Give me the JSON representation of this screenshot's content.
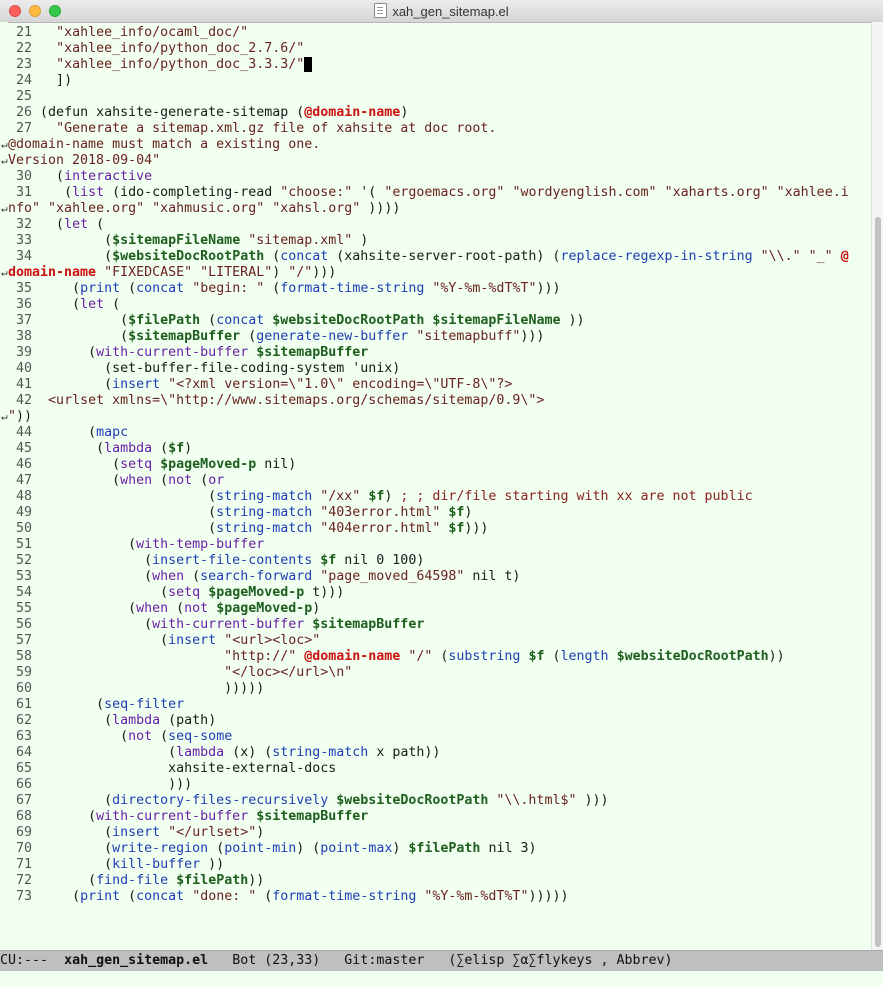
{
  "window": {
    "title": "xah_gen_sitemap.el"
  },
  "modeline": {
    "status": "CU:---",
    "buffer_name": "xah_gen_sitemap.el",
    "position": "Bot (23,33)",
    "vc": "Git:master",
    "modes": "(∑elisp ∑α∑flykeys , Abbrev)"
  },
  "editor": {
    "lines": [
      [
        [
          "num",
          "21"
        ],
        [
          "t",
          "  "
        ],
        [
          "st",
          "\"xahlee_info/ocaml_doc/\""
        ]
      ],
      [
        [
          "num",
          "22"
        ],
        [
          "t",
          "  "
        ],
        [
          "st",
          "\"xahlee_info/python_doc_2.7.6/\""
        ]
      ],
      [
        [
          "num",
          "23"
        ],
        [
          "t",
          "  "
        ],
        [
          "st",
          "\"xahlee_info/python_doc_3.3.3/\""
        ],
        [
          "cursor",
          " "
        ]
      ],
      [
        [
          "num",
          "24"
        ],
        [
          "t",
          "  ])"
        ]
      ],
      [
        [
          "num",
          "25"
        ]
      ],
      [
        [
          "num",
          "26"
        ],
        [
          "t",
          "(defun xahsite-generate-sitemap ("
        ],
        [
          "par",
          "@domain-name"
        ],
        [
          "t",
          ")"
        ]
      ],
      [
        [
          "num",
          "27"
        ],
        [
          "t",
          "  "
        ],
        [
          "st",
          "\"Generate a sitemap.xml.gz file of xahsite at doc root."
        ]
      ],
      [
        [
          "st",
          "@domain-name must match a existing one."
        ]
      ],
      [
        [
          "st",
          "Version 2018-09-04\""
        ]
      ],
      [
        [
          "num",
          "30"
        ],
        [
          "t",
          "  ("
        ],
        [
          "kw",
          "interactive"
        ]
      ],
      [
        [
          "num",
          "31"
        ],
        [
          "t",
          "   ("
        ],
        [
          "kw",
          "list"
        ],
        [
          "t",
          " (ido-completing-read "
        ],
        [
          "st",
          "\"choose:\""
        ],
        [
          "t",
          " '( "
        ],
        [
          "st",
          "\"ergoemacs.org\""
        ],
        [
          "t",
          " "
        ],
        [
          "st",
          "\"wordyenglish.com\""
        ],
        [
          "t",
          " "
        ],
        [
          "st",
          "\"xaharts.org\""
        ],
        [
          "t",
          " "
        ],
        [
          "st",
          "\"xahlee.i"
        ]
      ],
      [
        [
          "st",
          "nfo\""
        ],
        [
          "t",
          " "
        ],
        [
          "st",
          "\"xahlee.org\""
        ],
        [
          "t",
          " "
        ],
        [
          "st",
          "\"xahmusic.org\""
        ],
        [
          "t",
          " "
        ],
        [
          "st",
          "\"xahsl.org\""
        ],
        [
          "t",
          " ))))"
        ]
      ],
      [
        [
          "num",
          "32"
        ],
        [
          "t",
          "  ("
        ],
        [
          "kw",
          "let"
        ],
        [
          "t",
          " ("
        ]
      ],
      [
        [
          "num",
          "33"
        ],
        [
          "t",
          "        ("
        ],
        [
          "var",
          "$sitemapFileName"
        ],
        [
          "t",
          " "
        ],
        [
          "st",
          "\"sitemap.xml\""
        ],
        [
          "t",
          " )"
        ]
      ],
      [
        [
          "num",
          "34"
        ],
        [
          "t",
          "        ("
        ],
        [
          "var",
          "$websiteDocRootPath"
        ],
        [
          "t",
          " ("
        ],
        [
          "fn",
          "concat"
        ],
        [
          "t",
          " (xahsite-server-root-path) ("
        ],
        [
          "fn",
          "replace-regexp-in-string"
        ],
        [
          "t",
          " "
        ],
        [
          "st",
          "\"\\\\.\""
        ],
        [
          "t",
          " "
        ],
        [
          "st",
          "\"_\""
        ],
        [
          "t",
          " "
        ],
        [
          "par",
          "@"
        ]
      ],
      [
        [
          "par",
          "domain-name"
        ],
        [
          "t",
          " "
        ],
        [
          "st",
          "\"FIXEDCASE\""
        ],
        [
          "t",
          " "
        ],
        [
          "st",
          "\"LITERAL\""
        ],
        [
          "t",
          ") "
        ],
        [
          "st",
          "\"/\""
        ],
        [
          "t",
          ")))"
        ]
      ],
      [
        [
          "num",
          "35"
        ],
        [
          "t",
          "    ("
        ],
        [
          "fn",
          "print"
        ],
        [
          "t",
          " ("
        ],
        [
          "fn",
          "concat"
        ],
        [
          "t",
          " "
        ],
        [
          "st",
          "\"begin: \""
        ],
        [
          "t",
          " ("
        ],
        [
          "fn",
          "format-time-string"
        ],
        [
          "t",
          " "
        ],
        [
          "st",
          "\"%Y-%m-%dT%T\""
        ],
        [
          "t",
          ")))"
        ]
      ],
      [
        [
          "num",
          "36"
        ],
        [
          "t",
          "    ("
        ],
        [
          "kw",
          "let"
        ],
        [
          "t",
          " ("
        ]
      ],
      [
        [
          "num",
          "37"
        ],
        [
          "t",
          "          ("
        ],
        [
          "var",
          "$filePath"
        ],
        [
          "t",
          " ("
        ],
        [
          "fn",
          "concat"
        ],
        [
          "t",
          " "
        ],
        [
          "var",
          "$websiteDocRootPath"
        ],
        [
          "t",
          " "
        ],
        [
          "var",
          "$sitemapFileName"
        ],
        [
          "t",
          " ))"
        ]
      ],
      [
        [
          "num",
          "38"
        ],
        [
          "t",
          "          ("
        ],
        [
          "var",
          "$sitemapBuffer"
        ],
        [
          "t",
          " ("
        ],
        [
          "fn",
          "generate-new-buffer"
        ],
        [
          "t",
          " "
        ],
        [
          "st",
          "\"sitemapbuff\""
        ],
        [
          "t",
          ")))"
        ]
      ],
      [
        [
          "num",
          "39"
        ],
        [
          "t",
          "      ("
        ],
        [
          "kw",
          "with-current-buffer"
        ],
        [
          "t",
          " "
        ],
        [
          "var",
          "$sitemapBuffer"
        ]
      ],
      [
        [
          "num",
          "40"
        ],
        [
          "t",
          "        (set-buffer-file-coding-system 'unix)"
        ]
      ],
      [
        [
          "num",
          "41"
        ],
        [
          "t",
          "        ("
        ],
        [
          "fn",
          "insert"
        ],
        [
          "t",
          " "
        ],
        [
          "st",
          "\"<?xml version=\\\"1.0\\\" encoding=\\\"UTF-8\\\"?>"
        ]
      ],
      [
        [
          "num",
          "42"
        ],
        [
          "st",
          " <urlset xmlns=\\\"http://www.sitemaps.org/schemas/sitemap/0.9\\\">"
        ]
      ],
      [
        [
          "st",
          "\""
        ],
        [
          "t",
          "))"
        ]
      ],
      [
        [
          "num",
          "44"
        ],
        [
          "t",
          "      ("
        ],
        [
          "fn",
          "mapc"
        ]
      ],
      [
        [
          "num",
          "45"
        ],
        [
          "t",
          "       ("
        ],
        [
          "kw",
          "lambda"
        ],
        [
          "t",
          " ("
        ],
        [
          "var",
          "$f"
        ],
        [
          "t",
          ")"
        ]
      ],
      [
        [
          "num",
          "46"
        ],
        [
          "t",
          "         ("
        ],
        [
          "kw",
          "setq"
        ],
        [
          "t",
          " "
        ],
        [
          "var",
          "$pageMoved-p"
        ],
        [
          "t",
          " nil)"
        ]
      ],
      [
        [
          "num",
          "47"
        ],
        [
          "t",
          "         ("
        ],
        [
          "kw",
          "when"
        ],
        [
          "t",
          " ("
        ],
        [
          "kw",
          "not"
        ],
        [
          "t",
          " ("
        ],
        [
          "kw",
          "or"
        ]
      ],
      [
        [
          "num",
          "48"
        ],
        [
          "t",
          "                     ("
        ],
        [
          "fn",
          "string-match"
        ],
        [
          "t",
          " "
        ],
        [
          "st",
          "\"/xx\""
        ],
        [
          "t",
          " "
        ],
        [
          "var",
          "$f"
        ],
        [
          "t",
          ") "
        ],
        [
          "cm",
          "; ; dir/file starting with xx are not public"
        ]
      ],
      [
        [
          "num",
          "49"
        ],
        [
          "t",
          "                     ("
        ],
        [
          "fn",
          "string-match"
        ],
        [
          "t",
          " "
        ],
        [
          "st",
          "\"403error.html\""
        ],
        [
          "t",
          " "
        ],
        [
          "var",
          "$f"
        ],
        [
          "t",
          ")"
        ]
      ],
      [
        [
          "num",
          "50"
        ],
        [
          "t",
          "                     ("
        ],
        [
          "fn",
          "string-match"
        ],
        [
          "t",
          " "
        ],
        [
          "st",
          "\"404error.html\""
        ],
        [
          "t",
          " "
        ],
        [
          "var",
          "$f"
        ],
        [
          "t",
          ")))"
        ]
      ],
      [
        [
          "num",
          "51"
        ],
        [
          "t",
          "           ("
        ],
        [
          "kw",
          "with-temp-buffer"
        ]
      ],
      [
        [
          "num",
          "52"
        ],
        [
          "t",
          "             ("
        ],
        [
          "fn",
          "insert-file-contents"
        ],
        [
          "t",
          " "
        ],
        [
          "var",
          "$f"
        ],
        [
          "t",
          " nil 0 100)"
        ]
      ],
      [
        [
          "num",
          "53"
        ],
        [
          "t",
          "             ("
        ],
        [
          "kw",
          "when"
        ],
        [
          "t",
          " ("
        ],
        [
          "fn",
          "search-forward"
        ],
        [
          "t",
          " "
        ],
        [
          "st",
          "\"page_moved_64598\""
        ],
        [
          "t",
          " nil t)"
        ]
      ],
      [
        [
          "num",
          "54"
        ],
        [
          "t",
          "               ("
        ],
        [
          "kw",
          "setq"
        ],
        [
          "t",
          " "
        ],
        [
          "var",
          "$pageMoved-p"
        ],
        [
          "t",
          " t)))"
        ]
      ],
      [
        [
          "num",
          "55"
        ],
        [
          "t",
          "           ("
        ],
        [
          "kw",
          "when"
        ],
        [
          "t",
          " ("
        ],
        [
          "kw",
          "not"
        ],
        [
          "t",
          " "
        ],
        [
          "var",
          "$pageMoved-p"
        ],
        [
          "t",
          ")"
        ]
      ],
      [
        [
          "num",
          "56"
        ],
        [
          "t",
          "             ("
        ],
        [
          "kw",
          "with-current-buffer"
        ],
        [
          "t",
          " "
        ],
        [
          "var",
          "$sitemapBuffer"
        ]
      ],
      [
        [
          "num",
          "57"
        ],
        [
          "t",
          "               ("
        ],
        [
          "fn",
          "insert"
        ],
        [
          "t",
          " "
        ],
        [
          "st",
          "\"<url><loc>\""
        ]
      ],
      [
        [
          "num",
          "58"
        ],
        [
          "t",
          "                       "
        ],
        [
          "st",
          "\"http://\""
        ],
        [
          "t",
          " "
        ],
        [
          "par",
          "@domain-name"
        ],
        [
          "t",
          " "
        ],
        [
          "st",
          "\"/\""
        ],
        [
          "t",
          " ("
        ],
        [
          "fn",
          "substring"
        ],
        [
          "t",
          " "
        ],
        [
          "var",
          "$f"
        ],
        [
          "t",
          " ("
        ],
        [
          "fn",
          "length"
        ],
        [
          "t",
          " "
        ],
        [
          "var",
          "$websiteDocRootPath"
        ],
        [
          "t",
          "))"
        ]
      ],
      [
        [
          "num",
          "59"
        ],
        [
          "t",
          "                       "
        ],
        [
          "st",
          "\"</loc></url>\\n\""
        ]
      ],
      [
        [
          "num",
          "60"
        ],
        [
          "t",
          "                       )))))"
        ]
      ],
      [
        [
          "num",
          "61"
        ],
        [
          "t",
          "       ("
        ],
        [
          "fn",
          "seq-filter"
        ]
      ],
      [
        [
          "num",
          "62"
        ],
        [
          "t",
          "        ("
        ],
        [
          "kw",
          "lambda"
        ],
        [
          "t",
          " (path)"
        ]
      ],
      [
        [
          "num",
          "63"
        ],
        [
          "t",
          "          ("
        ],
        [
          "kw",
          "not"
        ],
        [
          "t",
          " ("
        ],
        [
          "fn",
          "seq-some"
        ]
      ],
      [
        [
          "num",
          "64"
        ],
        [
          "t",
          "                ("
        ],
        [
          "kw",
          "lambda"
        ],
        [
          "t",
          " (x) ("
        ],
        [
          "fn",
          "string-match"
        ],
        [
          "t",
          " x path))"
        ]
      ],
      [
        [
          "num",
          "65"
        ],
        [
          "t",
          "                xahsite-external-docs"
        ]
      ],
      [
        [
          "num",
          "66"
        ],
        [
          "t",
          "                )))"
        ]
      ],
      [
        [
          "num",
          "67"
        ],
        [
          "t",
          "        ("
        ],
        [
          "fn",
          "directory-files-recursively"
        ],
        [
          "t",
          " "
        ],
        [
          "var",
          "$websiteDocRootPath"
        ],
        [
          "t",
          " "
        ],
        [
          "st",
          "\"\\\\.html$\""
        ],
        [
          "t",
          " )))"
        ]
      ],
      [
        [
          "num",
          "68"
        ],
        [
          "t",
          "      ("
        ],
        [
          "kw",
          "with-current-buffer"
        ],
        [
          "t",
          " "
        ],
        [
          "var",
          "$sitemapBuffer"
        ]
      ],
      [
        [
          "num",
          "69"
        ],
        [
          "t",
          "        ("
        ],
        [
          "fn",
          "insert"
        ],
        [
          "t",
          " "
        ],
        [
          "st",
          "\"</urlset>\""
        ],
        [
          "t",
          ")"
        ]
      ],
      [
        [
          "num",
          "70"
        ],
        [
          "t",
          "        ("
        ],
        [
          "fn",
          "write-region"
        ],
        [
          "t",
          " ("
        ],
        [
          "fn",
          "point-min"
        ],
        [
          "t",
          ") ("
        ],
        [
          "fn",
          "point-max"
        ],
        [
          "t",
          ") "
        ],
        [
          "var",
          "$filePath"
        ],
        [
          "t",
          " nil 3)"
        ]
      ],
      [
        [
          "num",
          "71"
        ],
        [
          "t",
          "        ("
        ],
        [
          "fn",
          "kill-buffer"
        ],
        [
          "t",
          " ))"
        ]
      ],
      [
        [
          "num",
          "72"
        ],
        [
          "t",
          "      ("
        ],
        [
          "fn",
          "find-file"
        ],
        [
          "t",
          " "
        ],
        [
          "var",
          "$filePath"
        ],
        [
          "t",
          "))"
        ]
      ],
      [
        [
          "num",
          "73"
        ],
        [
          "t",
          "    ("
        ],
        [
          "fn",
          "print"
        ],
        [
          "t",
          " ("
        ],
        [
          "fn",
          "concat"
        ],
        [
          "t",
          " "
        ],
        [
          "st",
          "\"done: \""
        ],
        [
          "t",
          " ("
        ],
        [
          "fn",
          "format-time-string"
        ],
        [
          "t",
          " "
        ],
        [
          "st",
          "\"%Y-%m-%dT%T\""
        ],
        [
          "t",
          ")))))"
        ]
      ]
    ]
  }
}
